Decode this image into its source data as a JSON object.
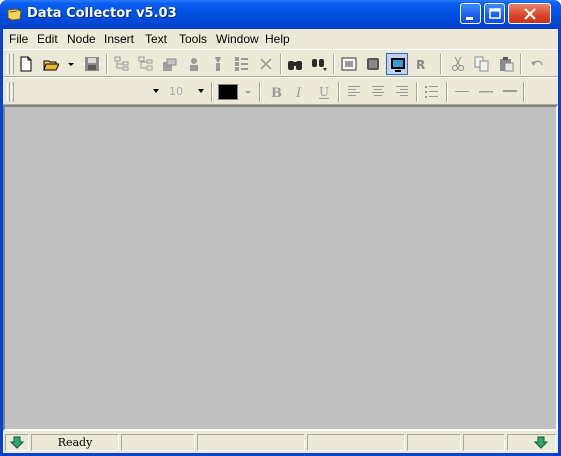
{
  "window": {
    "title": "Data Collector v5.03"
  },
  "menu": [
    "File",
    "Edit",
    "Node",
    "Insert",
    "Text",
    "Tools",
    "Window",
    "Help"
  ],
  "toolbar1": {
    "buttons": [
      "new-icon",
      "open-icon",
      "save-icon",
      "node-tree-icon",
      "node-tree-alt-icon",
      "node-add-icon",
      "node-edit-icon",
      "node-insert-icon",
      "node-list-icon",
      "delete-icon",
      "find-icon",
      "find-next-icon",
      "view-icon",
      "form-icon",
      "monitor-icon",
      "r-icon",
      "cut-icon",
      "copy-icon",
      "paste-icon",
      "undo-icon"
    ],
    "r_label": "R"
  },
  "toolbar2": {
    "font_name": "",
    "font_size": "10",
    "text_color": "#000000",
    "bold_label": "B",
    "italic_label": "I",
    "underline_label": "U"
  },
  "status": {
    "ready": "Ready"
  }
}
